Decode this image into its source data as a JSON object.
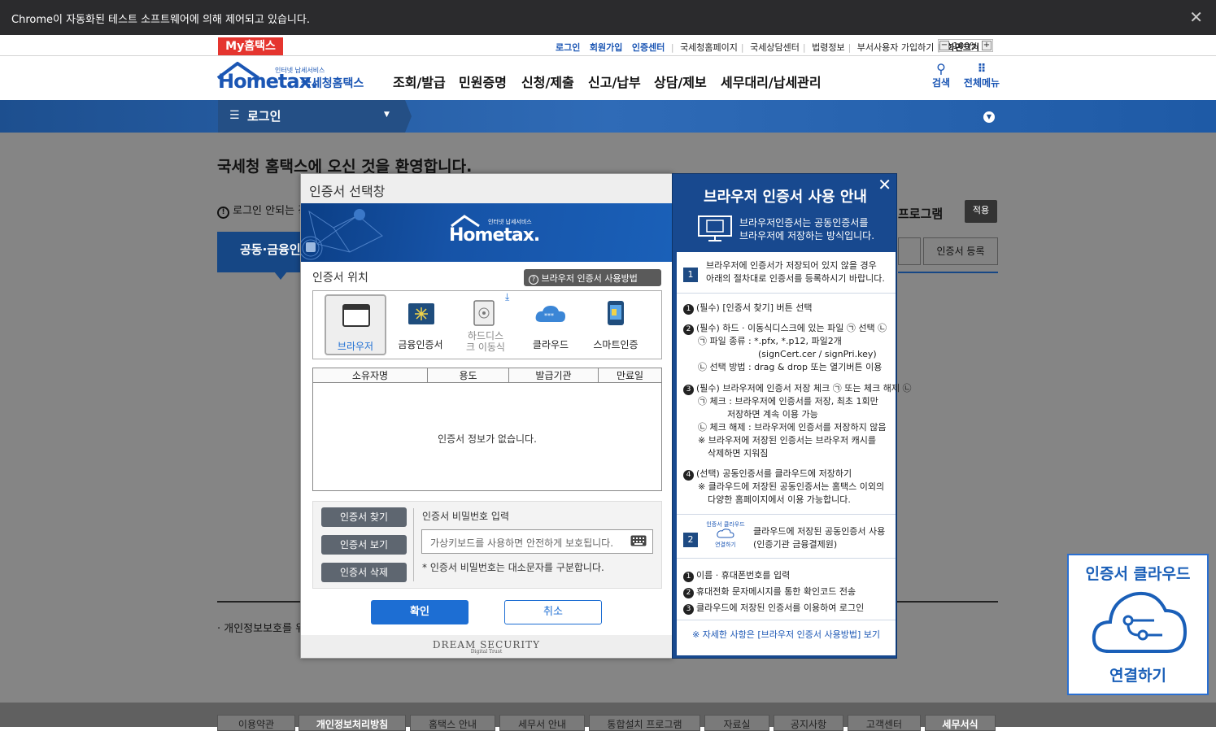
{
  "chrome": {
    "message": "Chrome이 자동화된 테스트 소프트웨어에 의해 제어되고 있습니다.",
    "close": "✕"
  },
  "util": {
    "my_hometax": "My홈택스",
    "links_bold": [
      "로그인",
      "회원가입",
      "인증센터"
    ],
    "links": [
      "국세청홈페이지",
      "국세상담센터",
      "법령정보",
      "부서사용자 가입하기"
    ],
    "zoom_label": "화면크기",
    "zoom_value": "100%"
  },
  "header": {
    "logo_small": "인터넷 납세서비스",
    "logo_main": "Hometax.",
    "logo_side": "국세청홈택스",
    "nav": [
      "조회/발급",
      "민원증명",
      "신청/제출",
      "신고/납부",
      "상담/제보",
      "세무대리/납세관리"
    ],
    "search_label": "검색",
    "menu_label": "전체메뉴"
  },
  "login_tab": "로그인",
  "page": {
    "welcome": "국세청 홈택스에 오신 것을 환영합니다.",
    "notice_partial": "로그인 안되는 경",
    "program_partial": "프로그램",
    "apply": "적용",
    "cert_register": "인증서 등록",
    "tab_partial": "공동·금융인",
    "privacy_partial": "· 개인정보보호를 위"
  },
  "footer": [
    "이용약관",
    "개인정보처리방침",
    "홈택스 안내",
    "세무서 안내",
    "통합설치 프로그램",
    "자료실",
    "공지사항",
    "고객센터",
    "세무서식"
  ],
  "dialog": {
    "title": "인증서 선택창",
    "banner_small": "인터넷 납세서비스",
    "banner_logo": "Hometax.",
    "location_title": "인증서 위치",
    "howto": "브라우저 인증서 사용방법",
    "locations": [
      "브라우저",
      "금융인증서",
      "하드디스크 이동식",
      "클라우드",
      "스마트인증"
    ],
    "columns": [
      "소유자명",
      "용도",
      "발급기관",
      "만료일"
    ],
    "empty": "인증서 정보가 없습니다.",
    "buttons": [
      "인증서 찾기",
      "인증서 보기",
      "인증서 삭제"
    ],
    "pw_label": "인증서 비밀번호 입력",
    "pw_placeholder": "가상키보드를 사용하면 안전하게 보호됩니다.",
    "pw_note": "* 인증서 비밀번호는 대소문자를 구분합니다.",
    "ok": "확인",
    "cancel": "취소",
    "vendor": "DREAM SECURITY",
    "vendor_sub": "Digital Trust"
  },
  "guide": {
    "title": "브라우저 인증서 사용 안내",
    "subtitle_1": "브라우저인증서는 공동인증서를",
    "subtitle_2": "브라우저에 저장하는 방식입니다.",
    "s1_num": "1",
    "s1_text_1": "브라우저에 인증서가 저장되어 있지 않을 경우",
    "s1_text_2": "아래의 절차대로 인증서를 등록하시기 바랍니다.",
    "lines": [
      "(필수) [인증서 찾기] 버튼 선택",
      "(필수) 하드 · 이동식디스크에 있는 파일 ㉠ 선택 ㉡",
      "㉠ 파일 종류 : *.pfx, *.p12, 파일2개",
      "(signCert.cer / signPri.key)",
      "㉡ 선택 방법 : drag & drop 또는 열기버튼 이용",
      "(필수) 브라우저에 인증서 저장 체크 ㉠ 또는 체크 해제 ㉡",
      "㉠ 체크 : 브라우저에 인증서를 저장, 최초 1회만",
      "저장하면 계속 이용 가능",
      "㉡ 체크 해제 : 브라우저에 인증서를 저장하지 않음",
      "※ 브라우저에 저장된 인증서는 브라우저 캐시를",
      "삭제하면 지워짐",
      "(선택) 공동인증서를 클라우드에 저장하기",
      "※ 클라우드에 저장된 공동인증서는 홈택스 이외의",
      "다양한 홈페이지에서 이용 가능합니다."
    ],
    "s2_num": "2",
    "s2_icon_top": "인증서 클라우드",
    "s2_icon_bottom": "연결하기",
    "s2_text_1": "클라우드에 저장된 공동인증서 사용",
    "s2_text_2": "(인증기관 금융결제원)",
    "steps2": [
      "이름 · 휴대폰번호를 입력",
      "휴대전화 문자메시지를 통한 확인코드 전송",
      "클라우드에 저장된 인증서를 이용하여 로그인"
    ],
    "footer": "※ 자세한 사항은 [브라우저 인증서 사용방법] 보기"
  },
  "cloud_card": {
    "top": "인증서 클라우드",
    "bottom": "연결하기"
  }
}
